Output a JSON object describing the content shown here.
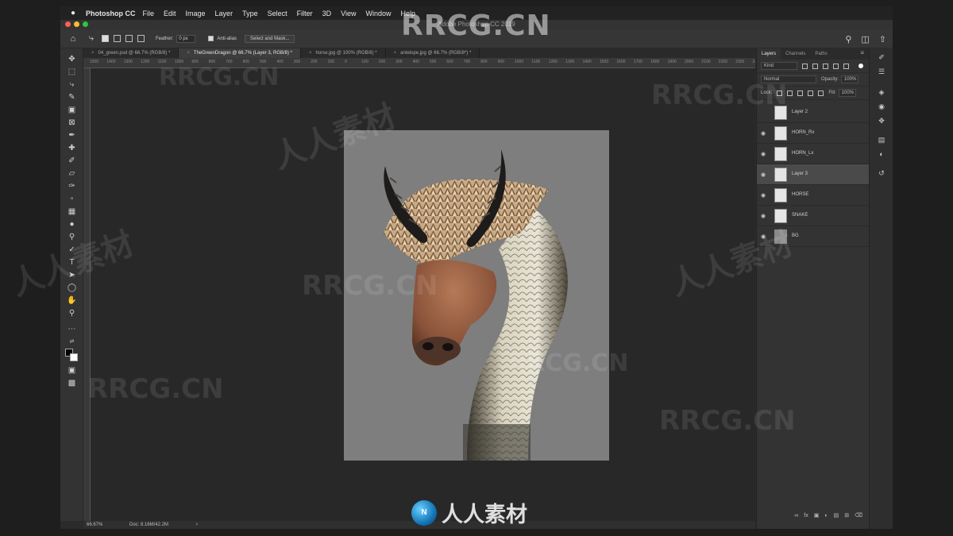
{
  "menubar": {
    "app_name": "Photoshop CC",
    "items": [
      "File",
      "Edit",
      "Image",
      "Layer",
      "Type",
      "Select",
      "Filter",
      "3D",
      "View",
      "Window",
      "Help"
    ]
  },
  "window": {
    "title": "Adobe Photoshop CC 2019"
  },
  "options_bar": {
    "feather_label": "Feather:",
    "feather_value": "0 px",
    "antialias_label": "Anti-alias",
    "select_mask_label": "Select and Mask..."
  },
  "tabs": [
    {
      "label": "04_green.psd @ 66.7% (RGB/8) *",
      "active": false
    },
    {
      "label": "TheGreenDragon @ 66.7% (Layer 3, RGB/8) *",
      "active": true
    },
    {
      "label": "horse.jpg @ 100% (RGB/8) *",
      "active": false
    },
    {
      "label": "antelope.jpg @ 66.7% (RGB/8*) *",
      "active": false
    }
  ],
  "ruler_ticks": [
    "1500",
    "1400",
    "1300",
    "1200",
    "1100",
    "1000",
    "900",
    "800",
    "700",
    "600",
    "500",
    "400",
    "300",
    "200",
    "100",
    "0",
    "100",
    "200",
    "300",
    "400",
    "500",
    "600",
    "700",
    "800",
    "900",
    "1000",
    "1100",
    "1200",
    "1300",
    "1400",
    "1500",
    "1600",
    "1700",
    "1800",
    "1900",
    "2000",
    "2100",
    "2200",
    "2300",
    "2400"
  ],
  "status": {
    "zoom": "66.67%",
    "doc": "Doc: 8.16M/42.2M",
    "arrow": ">"
  },
  "layers_panel": {
    "tabs": [
      "Layers",
      "Channels",
      "Paths"
    ],
    "kind_label": "Kind",
    "blend_mode": "Normal",
    "opacity_label": "Opacity:",
    "opacity_value": "100%",
    "lock_label": "Lock:",
    "fill_label": "Fill:",
    "fill_value": "100%",
    "layers": [
      {
        "name": "Layer 2",
        "visible": false,
        "selected": false
      },
      {
        "name": "HORN_Rx",
        "visible": true,
        "selected": false
      },
      {
        "name": "HORN_Lx",
        "visible": true,
        "selected": false
      },
      {
        "name": "Layer 3",
        "visible": true,
        "selected": true
      },
      {
        "name": "HORSE",
        "visible": true,
        "selected": false
      },
      {
        "name": "SNAKE",
        "visible": true,
        "selected": false
      },
      {
        "name": "BG",
        "visible": true,
        "selected": false
      }
    ],
    "footer_icons": [
      "link-icon",
      "fx-icon",
      "mask-icon",
      "adjustment-icon",
      "folder-icon",
      "new-layer-icon",
      "trash-icon"
    ]
  },
  "watermark": {
    "top_text": "RRCG.CN",
    "logo_text": "人人素材",
    "logo_initials": "N"
  },
  "colors": {
    "canvas_bg": "#282828",
    "document_bg": "#7e7e7e",
    "panel_bg": "#333333",
    "selected_layer": "#4a4a4a"
  }
}
